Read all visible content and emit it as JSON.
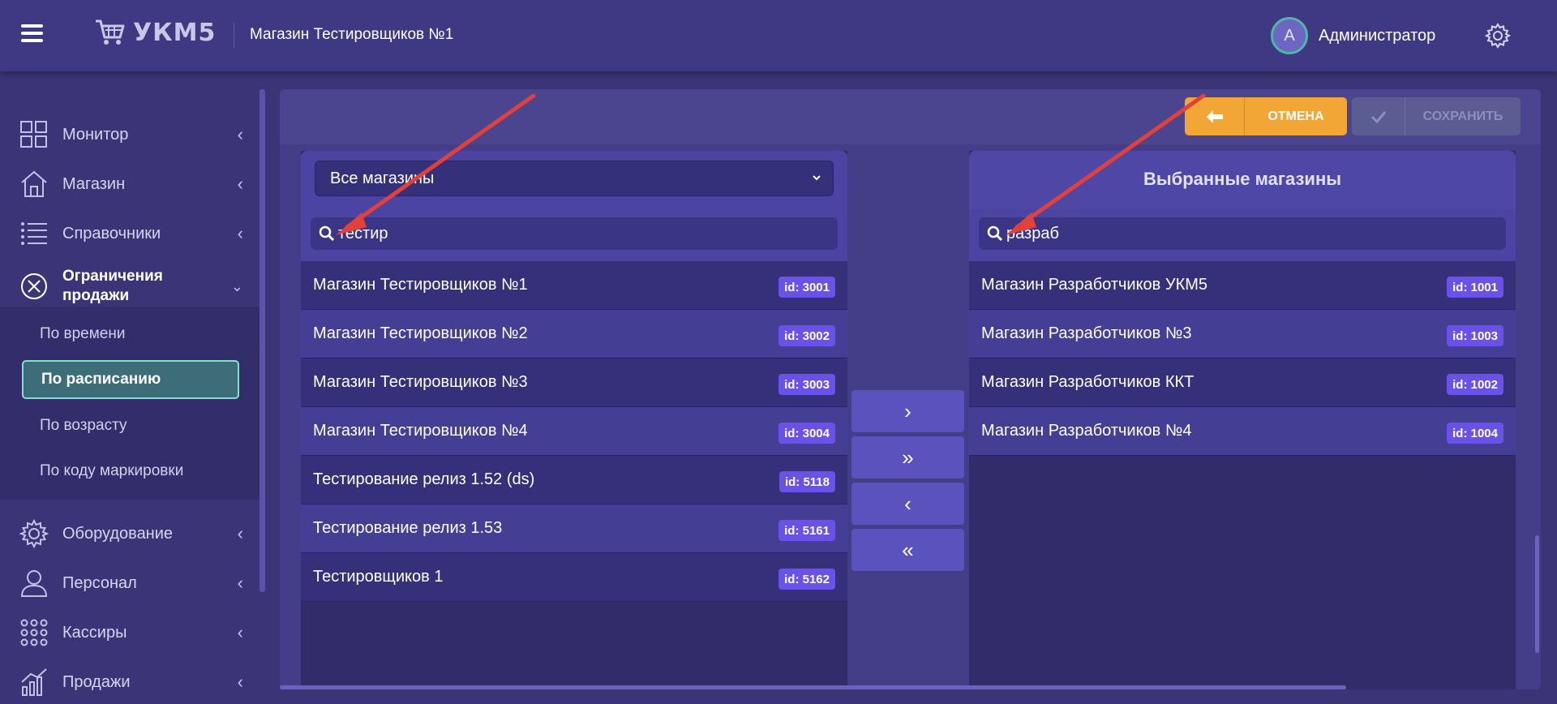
{
  "header": {
    "app_name": "УКМ5",
    "store_title": "Магазин Тестировщиков №1",
    "avatar_letter": "А",
    "user_name": "Администратор"
  },
  "sidebar": {
    "items": [
      {
        "label": "Монитор",
        "icon": "dashboard-icon"
      },
      {
        "label": "Магазин",
        "icon": "store-icon"
      },
      {
        "label": "Справочники",
        "icon": "list-icon"
      },
      {
        "label": "Ограничения продажи",
        "icon": "restriction-icon"
      },
      {
        "label": "Оборудование",
        "icon": "gear-icon"
      },
      {
        "label": "Персонал",
        "icon": "user-icon"
      },
      {
        "label": "Кассиры",
        "icon": "cashiers-icon"
      },
      {
        "label": "Продажи",
        "icon": "sales-chart-icon"
      }
    ],
    "subitems": [
      {
        "label": "По времени",
        "active": false
      },
      {
        "label": "По расписанию",
        "active": true
      },
      {
        "label": "По возрасту",
        "active": false
      },
      {
        "label": "По коду маркировки",
        "active": false
      }
    ]
  },
  "toolbar": {
    "cancel_label": "ОТМЕНА",
    "save_label": "СОХРАНИТЬ"
  },
  "left_panel": {
    "select_value": "Все магазины",
    "search_value": "тестир",
    "rows": [
      {
        "name": "Магазин Тестировщиков №1",
        "id": "id: 3001"
      },
      {
        "name": "Магазин Тестировщиков №2",
        "id": "id: 3002"
      },
      {
        "name": "Магазин Тестировщиков №3",
        "id": "id: 3003"
      },
      {
        "name": "Магазин Тестировщиков №4",
        "id": "id: 3004"
      },
      {
        "name": "Тестирование релиз 1.52 (ds)",
        "id": "id: 5118"
      },
      {
        "name": "Тестирование релиз 1.53",
        "id": "id: 5161"
      },
      {
        "name": "Тестировщиков 1",
        "id": "id: 5162"
      }
    ]
  },
  "right_panel": {
    "title": "Выбранные магазины",
    "search_value": "разраб",
    "rows": [
      {
        "name": "Магазин Разработчиков УКМ5",
        "id": "id: 1001"
      },
      {
        "name": "Магазин Разработчиков №3",
        "id": "id: 1003"
      },
      {
        "name": "Магазин Разработчиков ККТ",
        "id": "id: 1002"
      },
      {
        "name": "Магазин Разработчиков №4",
        "id": "id: 1004"
      }
    ]
  },
  "transfer_buttons": {
    "move_one": "›",
    "move_all": "»",
    "remove_one": "‹",
    "remove_all": "«"
  },
  "colors": {
    "accent_orange": "#f1a636",
    "badge": "#6a51e8",
    "active_item_border": "#7fe3c8",
    "annotation_arrow": "#e2413a"
  }
}
